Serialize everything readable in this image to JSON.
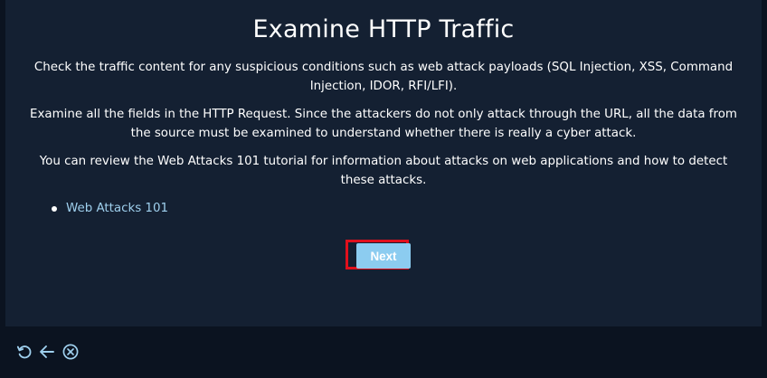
{
  "dialog": {
    "title": "Examine HTTP Traffic",
    "paragraphs": [
      "Check the traffic content for any suspicious conditions such as web attack payloads (SQL Injection, XSS, Command Injection, IDOR, RFI/LFI).",
      "Examine all the fields in the HTTP Request. Since the attackers do not only attack through the URL, all the data from the source must be examined to understand whether there is really a cyber attack.",
      "You can review the Web Attacks 101 tutorial for information about attacks on web applications and how to detect these attacks."
    ],
    "links": [
      {
        "label": "Web Attacks 101"
      }
    ],
    "next_label": "Next"
  },
  "toolbar": {
    "icons": [
      "restart-icon",
      "back-arrow-icon",
      "close-circle-icon"
    ]
  },
  "colors": {
    "background": "#0b1320",
    "panel": "#142032",
    "link": "#9fd0ee",
    "button": "#8cccf0",
    "highlight": "#e0101c"
  }
}
